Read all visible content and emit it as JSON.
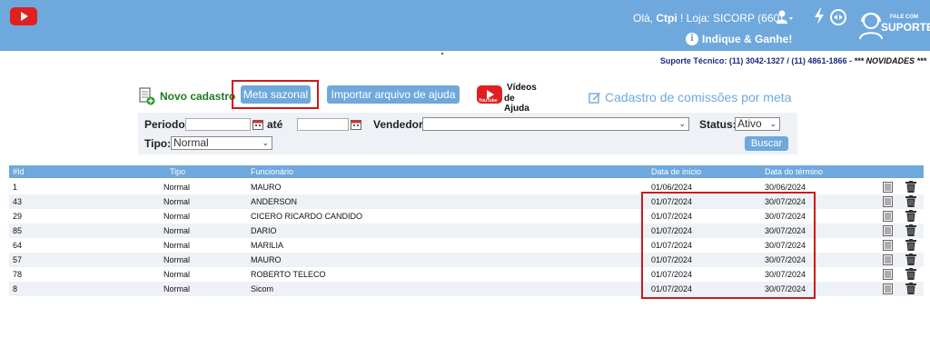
{
  "header": {
    "greeting_prefix": "Olá, ",
    "user_name": "Ctpi",
    "greeting_suffix": " !  Loja: SICORP (660)",
    "indique": "Indique & Ganhe!",
    "fale_com": "FALE COM",
    "suporte": "SUPORTE",
    "support_line": "Suporte Técnico: (11) 3042-1327 / (11) 4861-1866 - ",
    "novidades": "*** NOVIDADES ***",
    "accent": "#6fa8dc"
  },
  "actions": {
    "novo_cadastro": "Novo cadastro",
    "meta_sazonal": "Meta sazonal",
    "importar": "Importar arquivo de ajuda",
    "videos_line1": "Vídeos",
    "videos_line2": "de Ajuda",
    "youtube": "YouTube",
    "cadastro_comissoes": "Cadastro de comissões por meta",
    "highlight_color": "#d01818"
  },
  "filter": {
    "periodo_label": "Periodo:",
    "periodo_value": "",
    "ate_label": "até",
    "ate_value": "",
    "vendedor_label": "Vendedor:",
    "vendedor_value": "",
    "status_label": "Status:",
    "status_value": "Ativo",
    "tipo_label": "Tipo:",
    "tipo_value": "Normal",
    "buscar": "Buscar"
  },
  "table": {
    "headers": {
      "id": "#Id",
      "tipo": "Tipo",
      "funcionario": "Funcionário",
      "inicio": "Data de início",
      "termino": "Data do término"
    },
    "rows": [
      {
        "id": "1",
        "tipo": "Normal",
        "funcionario": "MAURO",
        "inicio": "01/06/2024",
        "termino": "30/06/2024"
      },
      {
        "id": "43",
        "tipo": "Normal",
        "funcionario": "ANDERSON",
        "inicio": "01/07/2024",
        "termino": "30/07/2024"
      },
      {
        "id": "29",
        "tipo": "Normal",
        "funcionario": "CICERO RICARDO CANDIDO",
        "inicio": "01/07/2024",
        "termino": "30/07/2024"
      },
      {
        "id": "85",
        "tipo": "Normal",
        "funcionario": "DARIO",
        "inicio": "01/07/2024",
        "termino": "30/07/2024"
      },
      {
        "id": "64",
        "tipo": "Normal",
        "funcionario": "MARILIA",
        "inicio": "01/07/2024",
        "termino": "30/07/2024"
      },
      {
        "id": "57",
        "tipo": "Normal",
        "funcionario": "MAURO",
        "inicio": "01/07/2024",
        "termino": "30/07/2024"
      },
      {
        "id": "78",
        "tipo": "Normal",
        "funcionario": "ROBERTO TELECO",
        "inicio": "01/07/2024",
        "termino": "30/07/2024"
      },
      {
        "id": "8",
        "tipo": "Normal",
        "funcionario": "Sicom",
        "inicio": "01/07/2024",
        "termino": "30/07/2024"
      }
    ]
  }
}
